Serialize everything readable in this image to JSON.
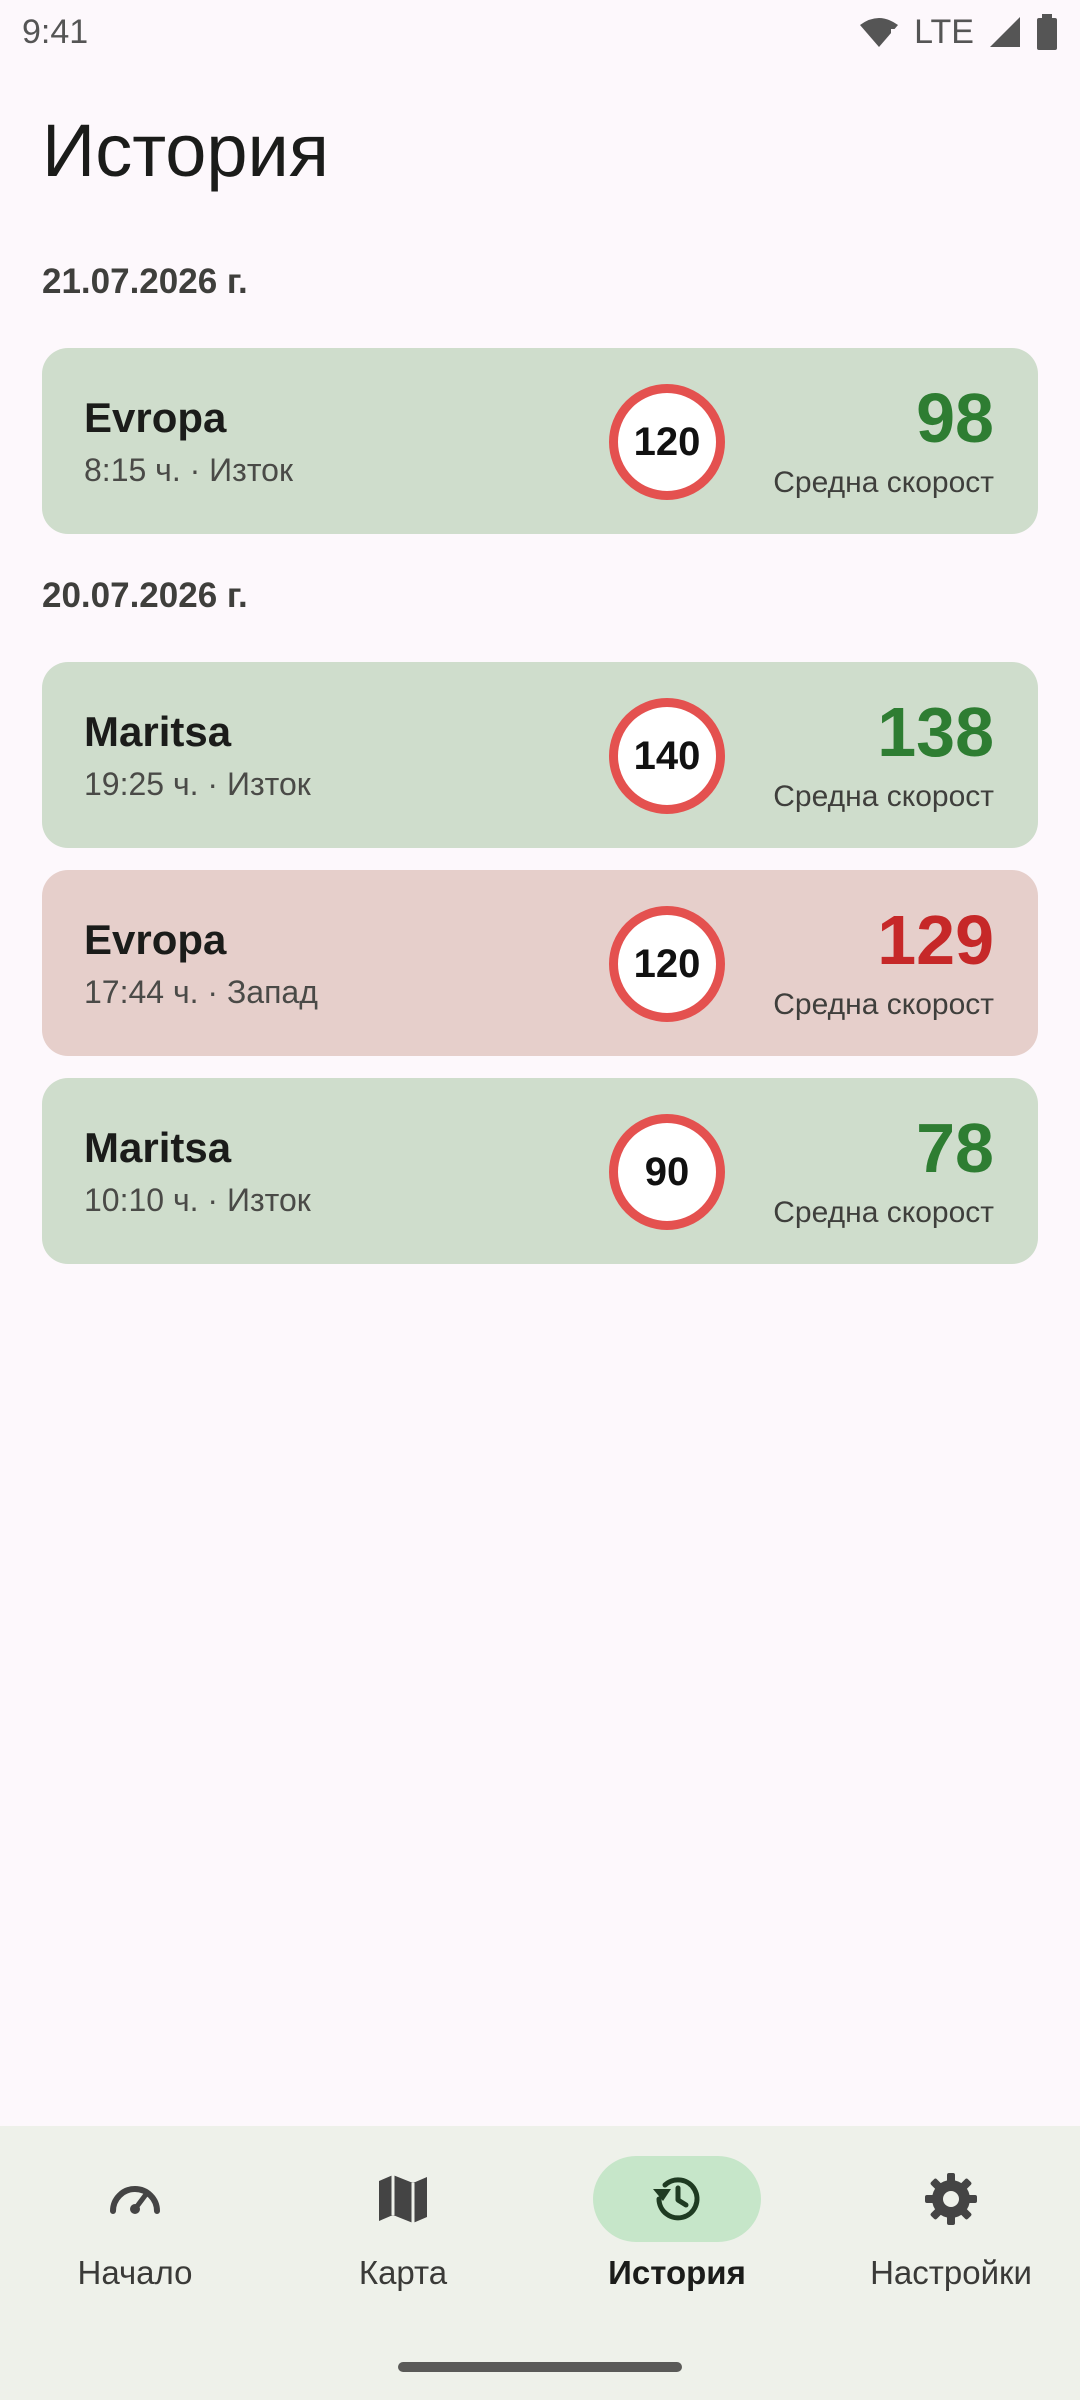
{
  "status_bar": {
    "time": "9:41",
    "network": "LTE",
    "icons": [
      "wifi-alert-icon",
      "cell-signal-icon",
      "battery-icon"
    ]
  },
  "page": {
    "title": "История"
  },
  "groups": [
    {
      "date": "21.07.2026 г.",
      "trips": [
        {
          "road": "Evropa",
          "meta": "8:15 ч. · Изток",
          "limit": "120",
          "avg": "98",
          "avg_label": "Средна скорост",
          "status": "ok"
        }
      ]
    },
    {
      "date": "20.07.2026 г.",
      "trips": [
        {
          "road": "Maritsa",
          "meta": "19:25 ч. · Изток",
          "limit": "140",
          "avg": "138",
          "avg_label": "Средна скорост",
          "status": "ok"
        },
        {
          "road": "Evropa",
          "meta": "17:44 ч. · Запад",
          "limit": "120",
          "avg": "129",
          "avg_label": "Средна скорост",
          "status": "over"
        },
        {
          "road": "Maritsa",
          "meta": "10:10 ч. · Изток",
          "limit": "90",
          "avg": "78",
          "avg_label": "Средна скорост",
          "status": "ok"
        }
      ]
    }
  ],
  "nav": {
    "items": [
      {
        "label": "Начало",
        "icon": "speedometer-icon",
        "active": false
      },
      {
        "label": "Карта",
        "icon": "map-icon",
        "active": false
      },
      {
        "label": "История",
        "icon": "history-icon",
        "active": true
      },
      {
        "label": "Настройки",
        "icon": "gear-icon",
        "active": false
      }
    ]
  },
  "colors": {
    "ok_card": "#cfddcc",
    "over_card": "#e6cfcb",
    "ok_text": "#2e7d32",
    "over_text": "#c62828",
    "limit_ring": "#e4514f",
    "active_pill": "#c6e6c9"
  }
}
